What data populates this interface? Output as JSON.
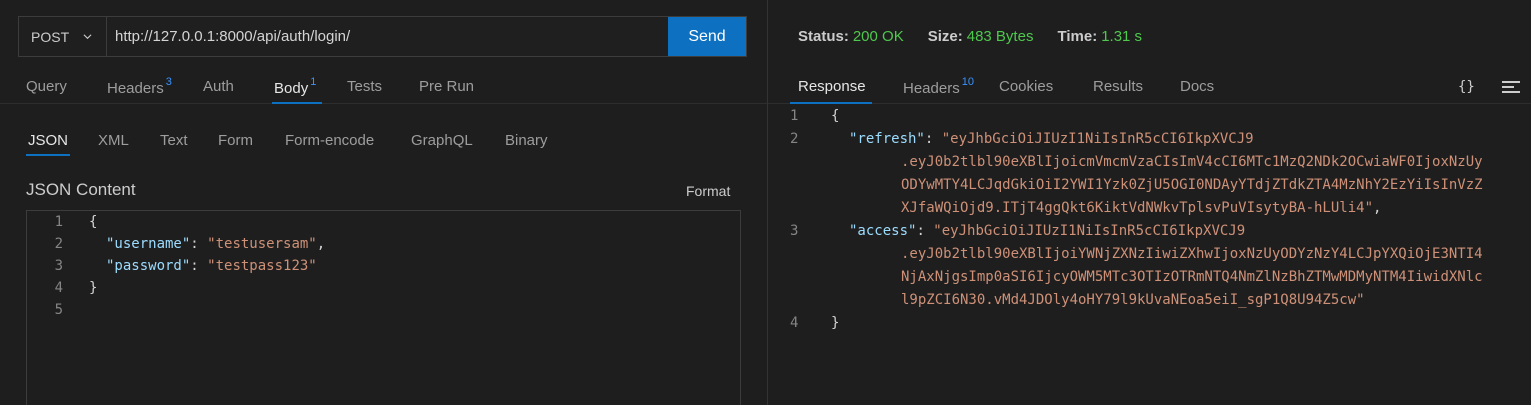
{
  "request": {
    "method": "POST",
    "url": "http://127.0.0.1:8000/api/auth/login/",
    "send_label": "Send",
    "tabs": [
      {
        "label": "Query",
        "badge": ""
      },
      {
        "label": "Headers",
        "badge": "3"
      },
      {
        "label": "Auth",
        "badge": ""
      },
      {
        "label": "Body",
        "badge": "1"
      },
      {
        "label": "Tests",
        "badge": ""
      },
      {
        "label": "Pre Run",
        "badge": ""
      }
    ],
    "active_tab": "Body",
    "body_types": [
      "JSON",
      "XML",
      "Text",
      "Form",
      "Form-encode",
      "GraphQL",
      "Binary"
    ],
    "active_body_type": "JSON",
    "content_title": "JSON Content",
    "format_label": "Format",
    "body_lines": {
      "l1_brace": "{",
      "l2_key": "\"username\"",
      "l2_val": "\"testusersam\"",
      "l3_key": "\"password\"",
      "l3_val": "\"testpass123\"",
      "l4_brace": "}"
    },
    "line_numbers": [
      "1",
      "2",
      "3",
      "4",
      "5"
    ]
  },
  "response": {
    "status_label": "Status:",
    "status_value": "200 OK",
    "size_label": "Size:",
    "size_value": "483 Bytes",
    "time_label": "Time:",
    "time_value": "1.31 s",
    "tabs": [
      {
        "label": "Response",
        "badge": ""
      },
      {
        "label": "Headers",
        "badge": "10"
      },
      {
        "label": "Cookies",
        "badge": ""
      },
      {
        "label": "Results",
        "badge": ""
      },
      {
        "label": "Docs",
        "badge": ""
      }
    ],
    "active_tab": "Response",
    "braces_icon": "{}",
    "line_numbers": [
      "1",
      "2",
      "3",
      "4"
    ],
    "json": {
      "open": "{",
      "refresh_key": "\"refresh\"",
      "refresh_wrap_1": "\"eyJhbGciOiJIUzI1NiIsInR5cCI6IkpXVCJ9",
      "refresh_wrap_2": ".eyJ0b2tlbl90eXBlIjoicmVmcmVzaCIsImV4cCI6MTc1MzQ2NDk2OCwiaWF0IjoxNzUy",
      "refresh_wrap_3": "ODYwMTY4LCJqdGkiOiI2YWI1Yzk0ZjU5OGI0NDAyYTdjZTdkZTA4MzNhY2EzYiIsInVzZ",
      "refresh_wrap_4": "XJfaWQiOjd9.ITjT4ggQkt6KiktVdNWkvTplsvPuVIsytyBA-hLUli4\"",
      "access_key": "\"access\"",
      "access_wrap_1": "\"eyJhbGciOiJIUzI1NiIsInR5cCI6IkpXVCJ9",
      "access_wrap_2": ".eyJ0b2tlbl90eXBlIjoiYWNjZXNzIiwiZXhwIjoxNzUyODYzNzY4LCJpYXQiOjE3NTI4",
      "access_wrap_3": "NjAxNjgsImp0aSI6IjcyOWM5MTc3OTIzOTRmNTQ4NmZlNzBhZTMwMDMyNTM4IiwidXNlc",
      "access_wrap_4": "l9pZCI6N30.vMd4JDOly4oHY79l9kUvaNEoa5eiI_sgP1Q8U94Z5cw\"",
      "close": "}"
    }
  },
  "colors": {
    "accent": "#0e70c0",
    "status_ok": "#4ec94e",
    "json_key": "#9cdcfe",
    "json_string": "#ce9178",
    "badge": "#3794ff"
  }
}
